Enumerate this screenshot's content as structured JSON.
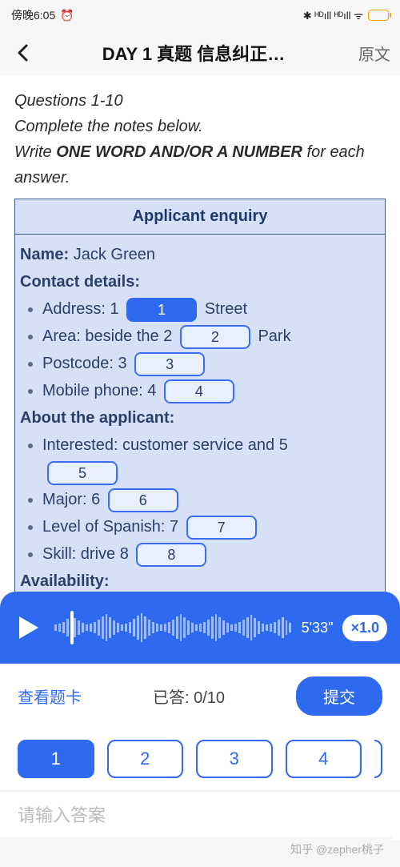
{
  "statusbar": {
    "time_label": "傍晚6:05",
    "icons_right": "✱ HD HD ᯤ ⚡"
  },
  "nav": {
    "title": "DAY 1 真题 信息纠正…",
    "right": "原文"
  },
  "instructions": {
    "line1": "Questions 1-10",
    "line2": "Complete the notes below.",
    "line3_pre": "Write ",
    "line3_strong": "ONE WORD AND/OR A NUMBER",
    "line3_post": " for each answer."
  },
  "form": {
    "title": "Applicant enquiry",
    "name_label": "Name:",
    "name_value": "Jack Green",
    "contact_label": "Contact details:",
    "address_pre": "Address: 1 ",
    "address_post": " Street",
    "area_pre": "Area: beside the 2 ",
    "area_post": " Park",
    "postcode_pre": "Postcode: 3 ",
    "mobile_pre": "Mobile phone: 4 ",
    "about_label": "About the applicant:",
    "interested_pre": "Interested: customer service and 5",
    "major_pre": "Major: 6 ",
    "spanish_pre": "Level of Spanish: 7 ",
    "skill_pre": "Skill: drive 8 ",
    "availability_label": "Availability:"
  },
  "blanks": {
    "b1": "1",
    "b2": "2",
    "b3": "3",
    "b4": "4",
    "b5": "5",
    "b6": "6",
    "b7": "7",
    "b8": "8"
  },
  "audio": {
    "duration": "5'33\"",
    "speed": "×1.0"
  },
  "actions": {
    "view_card": "查看题卡",
    "progress_label": "已答:",
    "progress_value": "0/10",
    "submit": "提交"
  },
  "qnav": {
    "q1": "1",
    "q2": "2",
    "q3": "3",
    "q4": "4"
  },
  "answer": {
    "placeholder": "请输入答案"
  },
  "watermark": "知乎 @zepher桃子"
}
